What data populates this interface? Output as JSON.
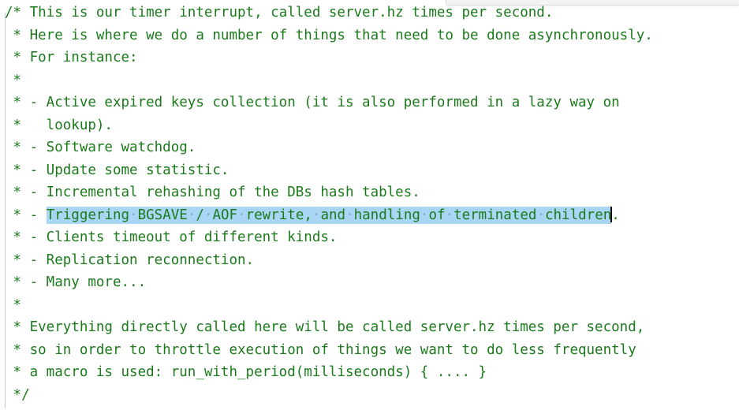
{
  "editor": {
    "language": "c",
    "text_color": "#1b7a1b",
    "background_color": "#ffffff",
    "selection_color": "#a9d6f5",
    "caret_color": "#000000",
    "indent_guide_color": "#c8c8c8"
  },
  "comment_block": {
    "lines": [
      "/* This is our timer interrupt, called server.hz times per second.",
      " * Here is where we do a number of things that need to be done asynchronously.",
      " * For instance:",
      " *",
      " * - Active expired keys collection (it is also performed in a lazy way on",
      " *   lookup).",
      " * - Software watchdog.",
      " * - Update some statistic.",
      " * - Incremental rehashing of the DBs hash tables.",
      " * - Triggering BGSAVE / AOF rewrite, and handling of terminated children.",
      " * - Clients timeout of different kinds.",
      " * - Replication reconnection.",
      " * - Many more...",
      " *",
      " * Everything directly called here will be called server.hz times per second,",
      " * so in order to throttle execution of things we want to do less frequently",
      " * a macro is used: run_with_period(milliseconds) { .... }",
      " */"
    ]
  },
  "lines": [
    {
      "prefix": "/* ",
      "body": "This is our timer interrupt, called server.hz times per second."
    },
    {
      "prefix": " * ",
      "body": "Here is where we do a number of things that need to be done asynchronously."
    },
    {
      "prefix": " * ",
      "body": "For instance:"
    },
    {
      "prefix": " *",
      "body": ""
    },
    {
      "prefix": " * ",
      "body": "- Active expired keys collection (it is also performed in a lazy way on"
    },
    {
      "prefix": " * ",
      "body": "  lookup)."
    },
    {
      "prefix": " * ",
      "body": "- Software watchdog."
    },
    {
      "prefix": " * ",
      "body": "- Update some statistic."
    },
    {
      "prefix": " * ",
      "body": "- Incremental rehashing of the DBs hash tables."
    },
    {
      "prefix": " * ",
      "body": "- Clients timeout of different kinds."
    },
    {
      "prefix": " * ",
      "body": "- Replication reconnection."
    },
    {
      "prefix": " * ",
      "body": "- Many more..."
    },
    {
      "prefix": " *",
      "body": ""
    },
    {
      "prefix": " * ",
      "body": "Everything directly called here will be called server.hz times per second,"
    },
    {
      "prefix": " * ",
      "body": "so in order to throttle execution of things we want to do less frequently"
    },
    {
      "prefix": " * ",
      "body": "a macro is used: run_with_period(milliseconds) { .... }"
    },
    {
      "prefix": " */",
      "body": ""
    }
  ],
  "selected_line": {
    "prefix": " * - ",
    "selected_text": "Triggering BGSAVE / AOF rewrite, and handling of terminated children",
    "trailing_text": ".",
    "words": [
      "Triggering",
      "BGSAVE",
      "/",
      "AOF",
      "rewrite,",
      "and",
      "handling",
      "of",
      "terminated",
      "children"
    ],
    "whitespace_marker": "·",
    "caret_visible": true
  }
}
